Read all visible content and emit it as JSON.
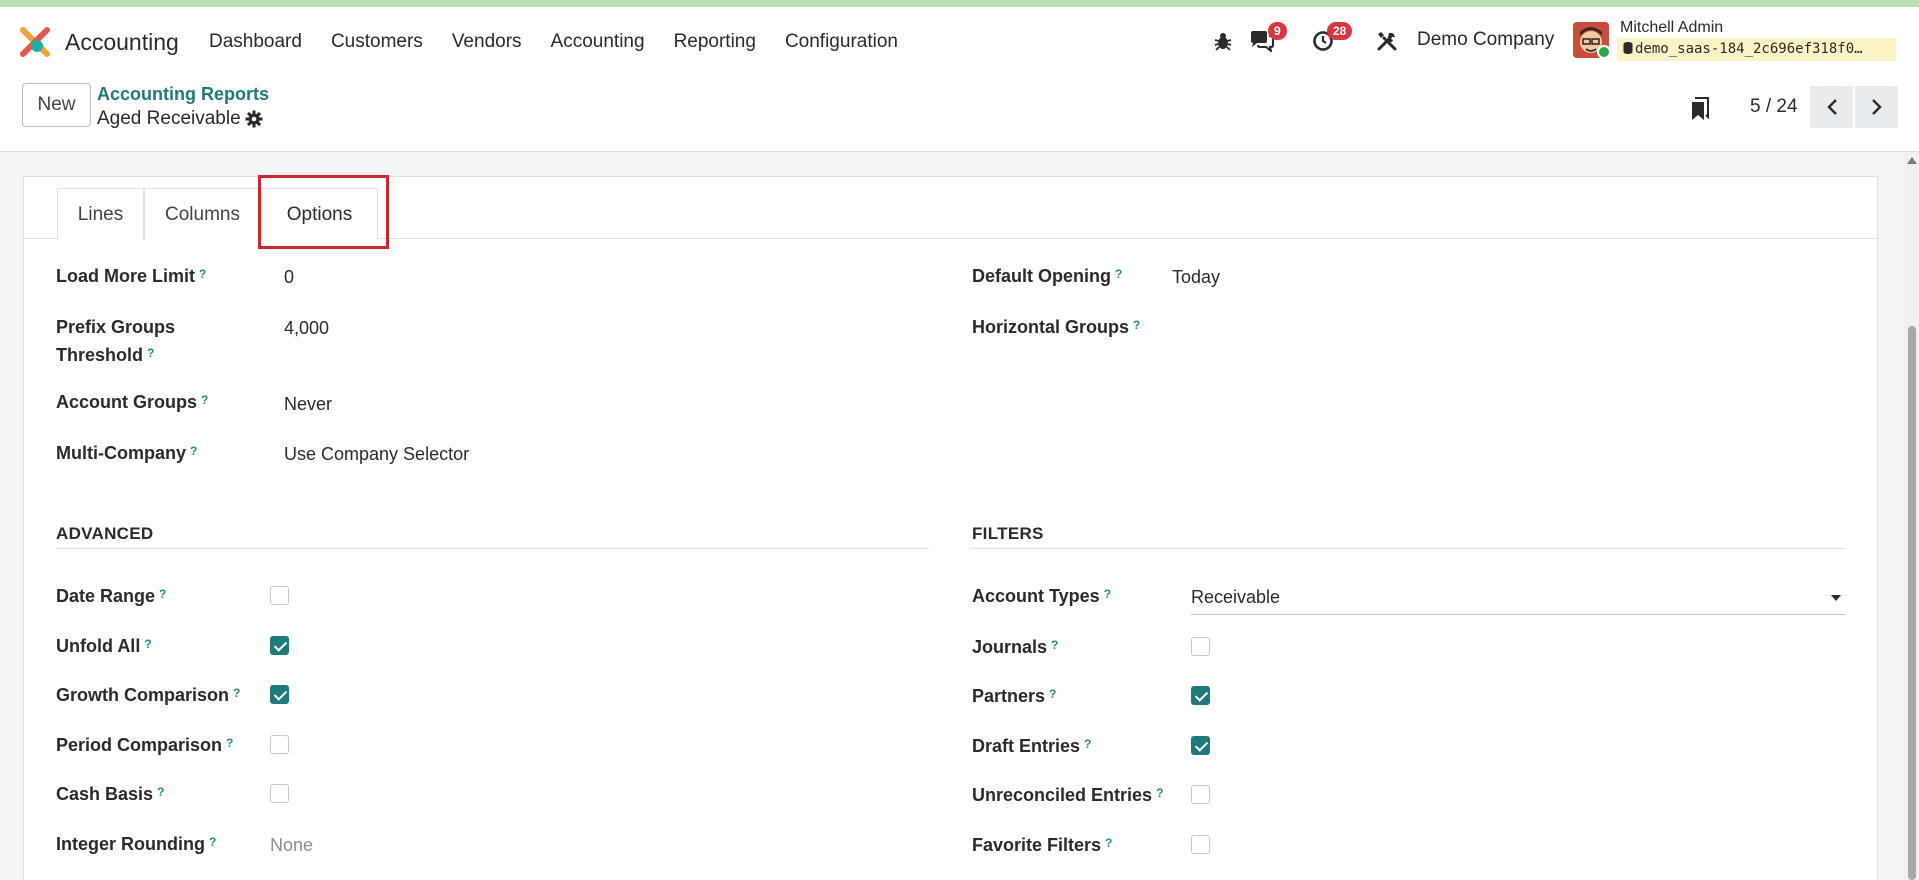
{
  "app": {
    "name": "Accounting"
  },
  "menu": [
    "Dashboard",
    "Customers",
    "Vendors",
    "Accounting",
    "Reporting",
    "Configuration"
  ],
  "systray": {
    "messages_count": "9",
    "activity_count": "28",
    "company": "Demo Company"
  },
  "user": {
    "name": "Mitchell Admin",
    "db": "demo_saas-184_2c696ef318f0…"
  },
  "control": {
    "new_label": "New",
    "breadcrumb": "Accounting Reports",
    "record_title": "Aged Receivable",
    "pager": "5 / 24"
  },
  "tabs": [
    "Lines",
    "Columns",
    "Options"
  ],
  "active_tab": "Options",
  "general_left": [
    {
      "label": "Load More Limit",
      "value": "0"
    },
    {
      "label": "Prefix Groups Threshold",
      "value": "4,000"
    },
    {
      "label": "Account Groups",
      "value": "Never"
    },
    {
      "label": "Multi-Company",
      "value": "Use Company Selector"
    }
  ],
  "general_right": [
    {
      "label": "Default Opening",
      "value": "Today"
    },
    {
      "label": "Horizontal Groups",
      "value": ""
    }
  ],
  "advanced": {
    "title": "ADVANCED",
    "fields": [
      {
        "label": "Date Range",
        "checked": false
      },
      {
        "label": "Unfold All",
        "checked": true
      },
      {
        "label": "Growth Comparison",
        "checked": true
      },
      {
        "label": "Period Comparison",
        "checked": false
      },
      {
        "label": "Cash Basis",
        "checked": false
      },
      {
        "label": "Integer Rounding",
        "value": "None"
      }
    ]
  },
  "filters": {
    "title": "FILTERS",
    "account_types_label": "Account Types",
    "account_types_value": "Receivable",
    "fields": [
      {
        "label": "Journals",
        "checked": false
      },
      {
        "label": "Partners",
        "checked": true
      },
      {
        "label": "Draft Entries",
        "checked": true
      },
      {
        "label": "Unreconciled Entries",
        "checked": false
      },
      {
        "label": "Favorite Filters",
        "checked": false
      }
    ]
  },
  "help_mark": "?",
  "colors": {
    "accent": "#1f7a7d",
    "badge": "#d9363e",
    "highlight": "#d02530"
  }
}
